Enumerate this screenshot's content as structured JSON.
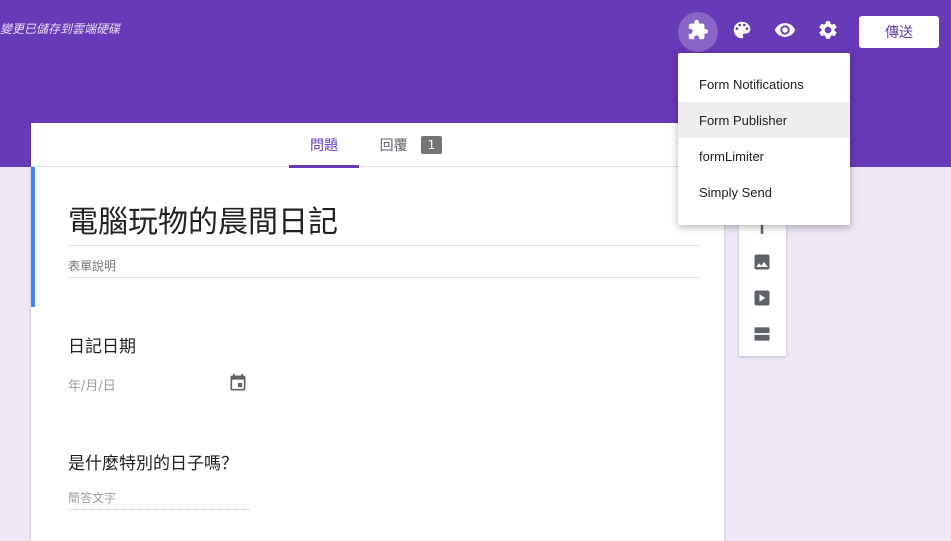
{
  "header": {
    "saved_status": "變更已儲存到雲端硬碟",
    "send_label": "傳送",
    "icons": [
      "addons-puzzle-icon",
      "palette-icon",
      "preview-eye-icon",
      "settings-gear-icon"
    ]
  },
  "tabs": {
    "questions_label": "問題",
    "responses_label": "回覆",
    "responses_count": "1"
  },
  "form": {
    "title": "電腦玩物的晨間日記",
    "description_placeholder": "表單說明",
    "questions": [
      {
        "title": "日記日期",
        "answer_placeholder": "年/月/日"
      },
      {
        "title": "是什麼特別的日子嗎？",
        "answer_placeholder": "簡答文字"
      }
    ]
  },
  "addons_menu": {
    "items": [
      "Form Notifications",
      "Form Publisher",
      "formLimiter",
      "Simply Send"
    ],
    "highlighted": "Form Publisher"
  },
  "colors": {
    "accent": "#673ab7",
    "background": "#ede7f6",
    "title_accent": "#4285f4"
  }
}
